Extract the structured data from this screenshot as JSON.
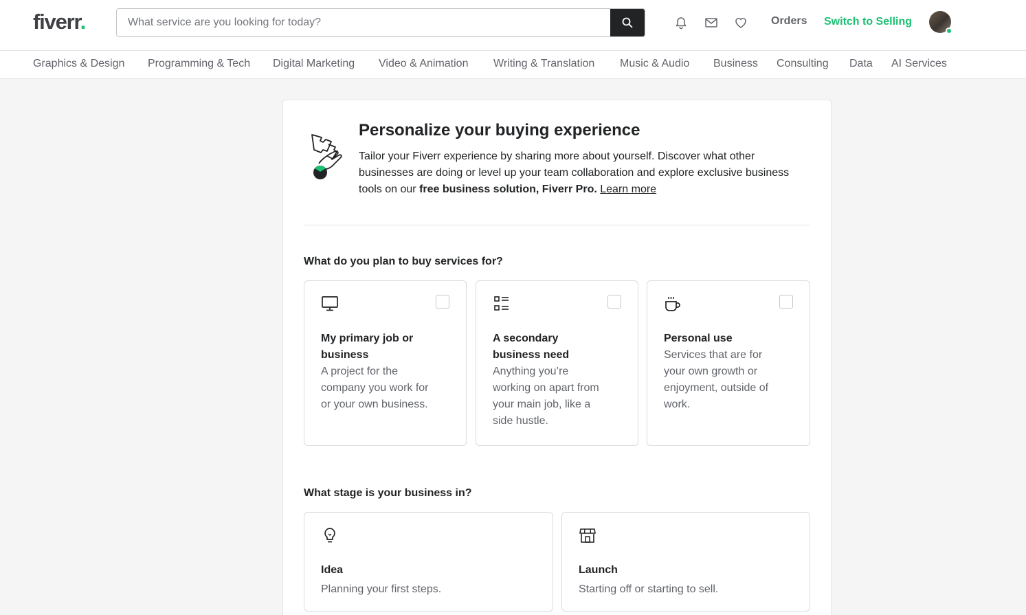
{
  "header": {
    "logo_text": "fiverr",
    "logo_dot": ".",
    "search_placeholder": "What service are you looking for today?",
    "orders_label": "Orders",
    "switch_label": "Switch to Selling",
    "brand_color": "#1dbf73"
  },
  "categories": [
    "Graphics & Design",
    "Programming & Tech",
    "Digital Marketing",
    "Video & Animation",
    "Writing & Translation",
    "Music & Audio",
    "Business",
    "Consulting",
    "Data",
    "AI Services"
  ],
  "intro": {
    "title": "Personalize your buying experience",
    "text_1": "Tailor your Fiverr experience by sharing more about yourself. Discover what other businesses are doing or level up your team collaboration and explore exclusive business tools on our ",
    "text_bold": "free business solution, Fiverr Pro.",
    "learn_more": "Learn more"
  },
  "purpose": {
    "question": "What do you plan to buy services for?",
    "options": [
      {
        "icon": "monitor-icon",
        "title": "My primary job or business",
        "desc": "A project for the company you work for or your own business."
      },
      {
        "icon": "list-icon",
        "title": "A secondary business need",
        "desc": "Anything you’re working on apart from your main job, like a side hustle."
      },
      {
        "icon": "coffee-cup-icon",
        "title": "Personal use",
        "desc": "Services that are for your own growth or enjoyment, outside of work."
      }
    ]
  },
  "stage": {
    "question": "What stage is your business in?",
    "options": [
      {
        "icon": "lightbulb-icon",
        "title": "Idea",
        "desc": "Planning your first steps."
      },
      {
        "icon": "storefront-icon",
        "title": "Launch",
        "desc": "Starting off or starting to sell."
      }
    ]
  }
}
